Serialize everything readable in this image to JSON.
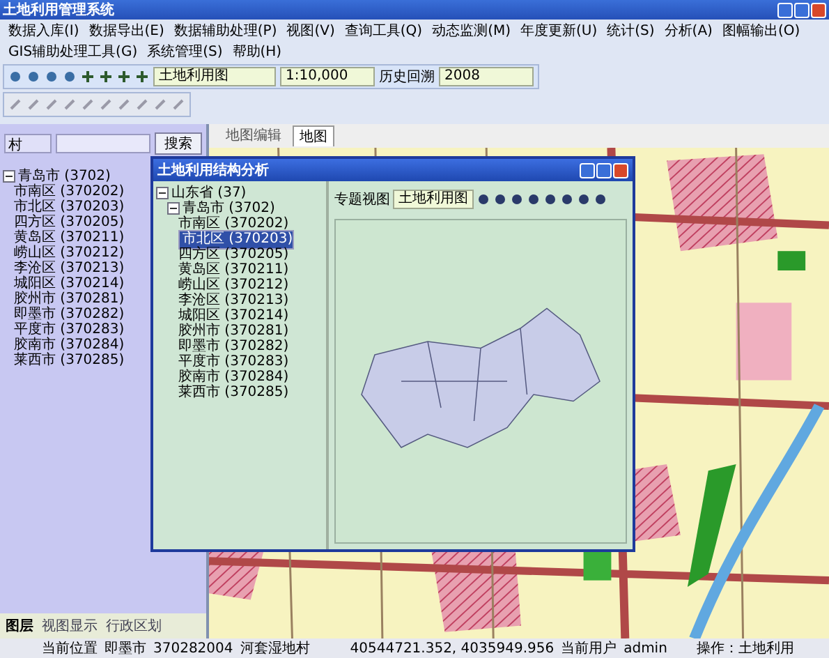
{
  "window": {
    "title": "土地利用管理系统"
  },
  "menu": [
    {
      "label": "数据入库(I)"
    },
    {
      "label": "数据导出(E)"
    },
    {
      "label": "数据辅助处理(P)"
    },
    {
      "label": "视图(V)"
    },
    {
      "label": "查询工具(Q)"
    },
    {
      "label": "动态监测(M)"
    },
    {
      "label": "年度更新(U)"
    },
    {
      "label": "统计(S)"
    },
    {
      "label": "分析(A)"
    },
    {
      "label": "图幅输出(O)"
    },
    {
      "label": "GIS辅助处理工具(G)"
    },
    {
      "label": "系统管理(S)"
    },
    {
      "label": "帮助(H)"
    }
  ],
  "toolbar": {
    "layer_select": "土地利用图",
    "scale": "1:10,000",
    "history_label": "历史回溯",
    "history_value": "2008"
  },
  "search": {
    "type": "村",
    "button": "搜索"
  },
  "left_tree": [
    {
      "label": "青岛市 (3702)",
      "expanded": true,
      "children": [
        {
          "label": "市南区 (370202)"
        },
        {
          "label": "市北区 (370203)"
        },
        {
          "label": "四方区 (370205)"
        },
        {
          "label": "黄岛区 (370211)"
        },
        {
          "label": "崂山区 (370212)"
        },
        {
          "label": "李沧区 (370213)"
        },
        {
          "label": "城阳区 (370214)"
        },
        {
          "label": "胶州市 (370281)"
        },
        {
          "label": "即墨市 (370282)"
        },
        {
          "label": "平度市 (370283)"
        },
        {
          "label": "胶南市 (370284)"
        },
        {
          "label": "莱西市 (370285)"
        }
      ]
    }
  ],
  "left_tabs": [
    {
      "label": "图层",
      "selected": true
    },
    {
      "label": "视图显示",
      "selected": false
    },
    {
      "label": "行政区划",
      "selected": false
    }
  ],
  "map_tabs": [
    {
      "label": "地图编辑",
      "selected": false
    },
    {
      "label": "地图",
      "selected": true
    }
  ],
  "dialog": {
    "title": "土地利用结构分析",
    "view_label": "专题视图",
    "view_value": "土地利用图",
    "tree": [
      {
        "label": "山东省 (37)",
        "selected": false,
        "expanded": true,
        "children": [
          {
            "label": "青岛市 (3702)",
            "selected": false,
            "expanded": true,
            "children": [
              {
                "label": "市南区 (370202)",
                "selected": false
              },
              {
                "label": "市北区 (370203)",
                "selected": true
              },
              {
                "label": "四方区 (370205)",
                "selected": false
              },
              {
                "label": "黄岛区 (370211)",
                "selected": false
              },
              {
                "label": "崂山区 (370212)",
                "selected": false
              },
              {
                "label": "李沧区 (370213)",
                "selected": false
              },
              {
                "label": "城阳区 (370214)",
                "selected": false
              },
              {
                "label": "胶州市 (370281)",
                "selected": false
              },
              {
                "label": "即墨市 (370282)",
                "selected": false
              },
              {
                "label": "平度市 (370283)",
                "selected": false
              },
              {
                "label": "胶南市 (370284)",
                "selected": false
              },
              {
                "label": "莱西市 (370285)",
                "selected": false
              }
            ]
          }
        ]
      }
    ]
  },
  "status_bar": {
    "location_label": "当前位置",
    "location_city": "即墨市",
    "location_code": "370282004",
    "location_village": "河套湿地村",
    "coordinates": "40544721.352, 4035949.956",
    "user_label": "当前用户",
    "user": "admin",
    "operation": "操作：土地利用"
  }
}
